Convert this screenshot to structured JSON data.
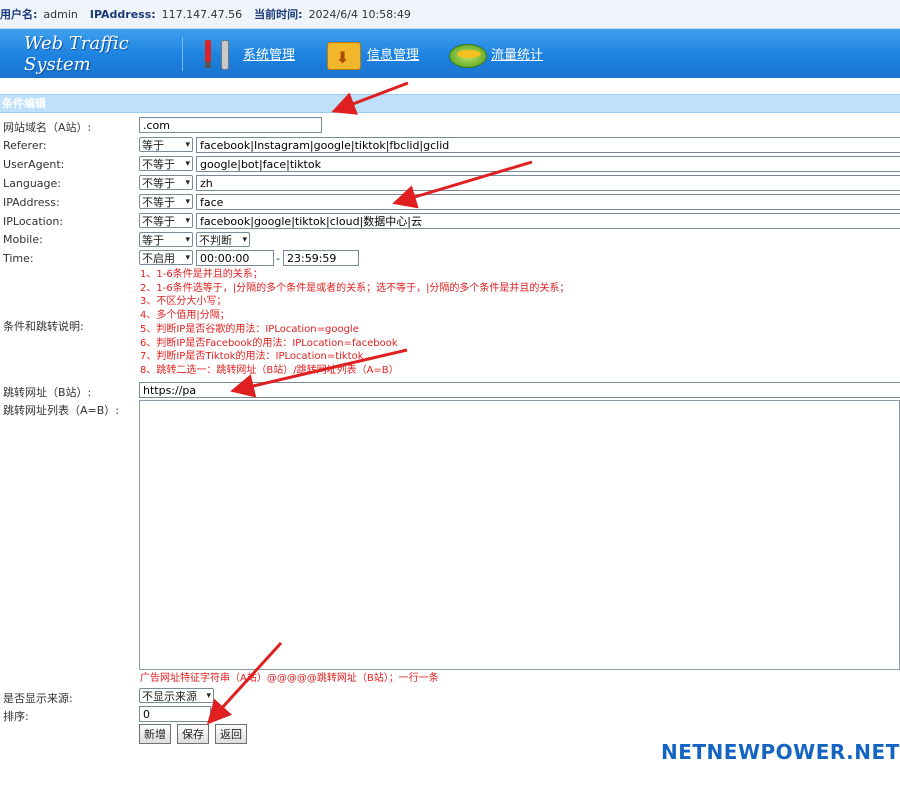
{
  "topbar": {
    "user_label": "用户名:",
    "user_value": "admin",
    "ip_label": "IPAddress:",
    "ip_value": "117.147.47.56",
    "time_label": "当前时间:",
    "time_value": "2024/6/4 10:58:49"
  },
  "header": {
    "logo": "Web Traffic System",
    "nav": [
      {
        "label": "系统管理",
        "icon": "tools-icon"
      },
      {
        "label": "信息管理",
        "icon": "folder-download-icon"
      },
      {
        "label": "流量统计",
        "icon": "stats-icon"
      }
    ]
  },
  "section_title": "条件编辑",
  "form": {
    "domain_label": "网站域名（A站）:",
    "domain_value": ".com",
    "referer_label": "Referer:",
    "referer_op": "等于",
    "referer_value": "facebook|Instagram|google|tiktok|fbclid|gclid",
    "ua_label": "UserAgent:",
    "ua_op": "不等于",
    "ua_value": "google|bot|face|tiktok",
    "lang_label": "Language:",
    "lang_op": "不等于",
    "lang_value": "zh",
    "ip_label": "IPAddress:",
    "ip_op": "不等于",
    "ip_value": "face",
    "iploc_label": "IPLocation:",
    "iploc_op": "不等于",
    "iploc_value": "facebook|google|tiktok|cloud|数据中心|云",
    "mobile_label": "Mobile:",
    "mobile_op": "等于",
    "mobile_value": "不判断",
    "time_label": "Time:",
    "time_op": "不启用",
    "time_start": "00:00:00",
    "time_sep": "-",
    "time_end": "23:59:59",
    "notes_label": "条件和跳转说明:",
    "notes": [
      "1、1-6条件是并且的关系；",
      "2、1-6条件选等于，|分隔的多个条件是或者的关系；选不等于，|分隔的多个条件是并且的关系；",
      "3、不区分大小写；",
      "4、多个值用|分隔；",
      "5、判断IP是否谷歌的用法：IPLocation=google",
      "6、判断IP是否Facebook的用法：IPLocation=facebook",
      "7、判断IP是否Tiktok的用法：IPLocation=tiktok",
      "8、跳转二选一：跳转网址（B站）/跳转网址列表（A=B）"
    ],
    "redirect_label": "跳转网址（B站）:",
    "redirect_value": "https://pa",
    "redirect_list_label": "跳转网址列表（A=B）:",
    "redirect_list_value": "",
    "list_note": "广告网址特征字符串（A站）@@@@@跳转网址（B站）；一行一条",
    "show_source_label": "是否显示来源:",
    "show_source_value": "不显示来源",
    "order_label": "排序:",
    "order_value": "0"
  },
  "buttons": {
    "add": "新增",
    "save": "保存",
    "back": "返回"
  },
  "watermark": "NETNEWPOWER.NET",
  "colors": {
    "banner": "#1d82e0",
    "section": "#bfe0fb",
    "note_red": "#e02020",
    "arrow_red": "#e02020",
    "watermark": "#1565c0"
  }
}
